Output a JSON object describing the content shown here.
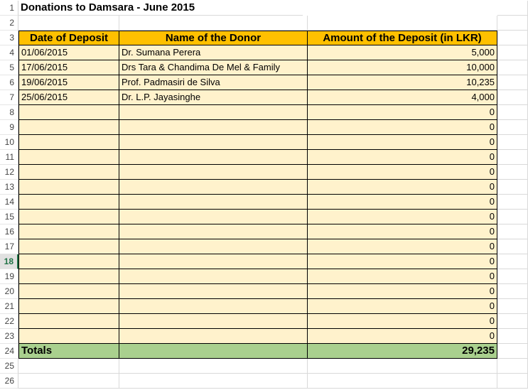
{
  "sheet": {
    "title": "Donations to Damsara - June 2015",
    "headers": [
      "Date of Deposit",
      "Name of the Donor",
      "Amount of the Deposit (in LKR)"
    ],
    "rows": [
      {
        "date": "01/06/2015",
        "name": "Dr. Sumana Perera",
        "amount": "5,000"
      },
      {
        "date": "17/06/2015",
        "name": "Drs Tara & Chandima De Mel & Family",
        "amount": "10,000"
      },
      {
        "date": "19/06/2015",
        "name": "Prof. Padmasiri de Silva",
        "amount": "10,235"
      },
      {
        "date": "25/06/2015",
        "name": "Dr. L.P. Jayasinghe",
        "amount": "4,000"
      },
      {
        "date": "",
        "name": "",
        "amount": "0"
      },
      {
        "date": "",
        "name": "",
        "amount": "0"
      },
      {
        "date": "",
        "name": "",
        "amount": "0"
      },
      {
        "date": "",
        "name": "",
        "amount": "0"
      },
      {
        "date": "",
        "name": "",
        "amount": "0"
      },
      {
        "date": "",
        "name": "",
        "amount": "0"
      },
      {
        "date": "",
        "name": "",
        "amount": "0"
      },
      {
        "date": "",
        "name": "",
        "amount": "0"
      },
      {
        "date": "",
        "name": "",
        "amount": "0"
      },
      {
        "date": "",
        "name": "",
        "amount": "0"
      },
      {
        "date": "",
        "name": "",
        "amount": "0"
      },
      {
        "date": "",
        "name": "",
        "amount": "0"
      },
      {
        "date": "",
        "name": "",
        "amount": "0"
      },
      {
        "date": "",
        "name": "",
        "amount": "0"
      },
      {
        "date": "",
        "name": "",
        "amount": "0"
      },
      {
        "date": "",
        "name": "",
        "amount": "0"
      }
    ],
    "totals_label": "Totals",
    "totals_value": "29,235",
    "row_numbers": [
      "1",
      "2",
      "3",
      "4",
      "5",
      "6",
      "7",
      "8",
      "9",
      "10",
      "11",
      "12",
      "13",
      "14",
      "15",
      "16",
      "17",
      "18",
      "19",
      "20",
      "21",
      "22",
      "23",
      "24",
      "25",
      "26"
    ],
    "active_row": "18"
  },
  "colors": {
    "header_fill": "#ffc000",
    "data_fill": "#fff2cc",
    "totals_fill": "#a9d08e",
    "active_row_accent": "#217346"
  }
}
